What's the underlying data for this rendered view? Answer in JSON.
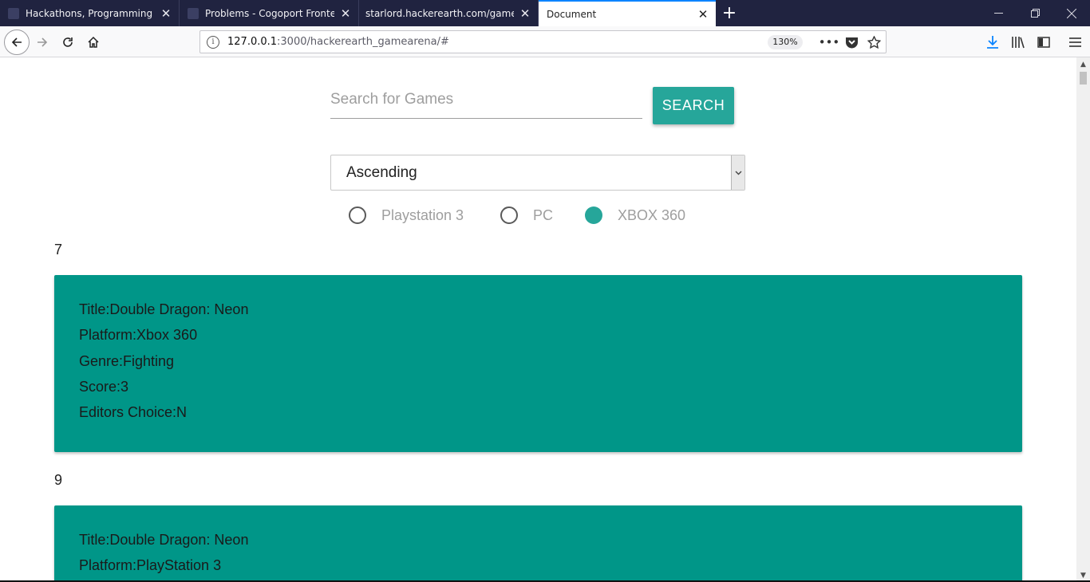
{
  "browser": {
    "tabs": [
      {
        "title": "Hackathons, Programming & C",
        "active": false
      },
      {
        "title": "Problems - Cogoport Frontend",
        "active": false
      },
      {
        "title": "starlord.hackerearth.com/gamesarena",
        "active": false
      },
      {
        "title": "Document",
        "active": true
      }
    ],
    "new_tab_icon": "+",
    "url_host": "127.0.0.1",
    "url_rest": ":3000/hackerearth_gamearena/#",
    "zoom": "130%"
  },
  "search": {
    "placeholder": "Search for Games",
    "button_label": "SEARCH"
  },
  "sort": {
    "selected": "Ascending"
  },
  "platform_filter": {
    "options": [
      {
        "label": "Playstation 3",
        "selected": false
      },
      {
        "label": "PC",
        "selected": false
      },
      {
        "label": "XBOX 360",
        "selected": true
      }
    ]
  },
  "results": [
    {
      "index": "7",
      "lines": [
        "Title:Double Dragon: Neon",
        "Platform:Xbox 360",
        "Genre:Fighting",
        "Score:3",
        "Editors Choice:N"
      ]
    },
    {
      "index": "9",
      "lines": [
        "Title:Double Dragon: Neon",
        "Platform:PlayStation 3"
      ]
    }
  ],
  "colors": {
    "accent": "#26a69a",
    "card": "#009688",
    "tab_bar": "#202340"
  }
}
